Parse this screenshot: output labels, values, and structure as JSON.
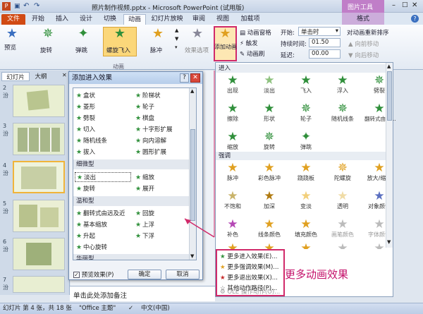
{
  "titlebar": {
    "title": "照片制作视频.pptx - Microsoft PowerPoint (试用版)",
    "context_tool": "图片工具"
  },
  "tabs": [
    "文件",
    "开始",
    "插入",
    "设计",
    "切换",
    "动画",
    "幻灯片放映",
    "审阅",
    "视图",
    "加载项",
    "格式"
  ],
  "ribbon": {
    "preview": "预览",
    "effects": [
      "旋转",
      "弹跳",
      "螺旋飞入",
      "脉冲"
    ],
    "effect_options": "效果选项",
    "group_animation": "动画",
    "add_animation": "添加动画",
    "animation_pane": "动画窗格",
    "trigger": "触发",
    "painter": "动画刷",
    "start_label": "开始:",
    "start_value": "单击时",
    "duration_label": "持续时间:",
    "duration_value": "01.50",
    "delay_label": "延迟:",
    "delay_value": "00.00",
    "reorder": "对动画重新排序",
    "move_earlier": "向前移动",
    "move_later": "向后移动"
  },
  "left_panel": {
    "tab_slides": "幻灯片",
    "tab_outline": "大纲",
    "slide_numbers": [
      "2",
      "3",
      "4",
      "5",
      "6",
      "7"
    ],
    "slide_suffix": "汾"
  },
  "dialog": {
    "title": "添加进入效果",
    "basic_items": [
      [
        "盒状",
        "阶梯状"
      ],
      [
        "菱形",
        "轮子"
      ],
      [
        "劈裂",
        "棋盘"
      ],
      [
        "切入",
        "十字形扩展"
      ],
      [
        "随机线条",
        "向内溶解"
      ],
      [
        "拔入",
        "圆形扩展"
      ]
    ],
    "section_subtle": "细微型",
    "subtle_items": [
      [
        "淡出",
        "缩放"
      ],
      [
        "旋转",
        "展开"
      ]
    ],
    "section_moderate": "温和型",
    "moderate_items": [
      [
        "翻转式由远及近",
        "回旋"
      ],
      [
        "基本缩放",
        "上浮"
      ],
      [
        "升起",
        "下浮"
      ],
      [
        "中心旋转",
        ""
      ]
    ],
    "section_exciting": "华丽型",
    "preview_checkbox": "预览效果(P)",
    "ok": "确定",
    "cancel": "取消"
  },
  "gallery": {
    "section_entrance": "进入",
    "entrance_row1": [
      "出现",
      "淡出",
      "飞入",
      "浮入",
      "劈裂"
    ],
    "entrance_row2": [
      "擦除",
      "形状",
      "轮子",
      "随机线条",
      "翻转式由远..."
    ],
    "entrance_row3": [
      "缩放",
      "旋转",
      "弹跳"
    ],
    "section_emphasis": "强调",
    "emphasis_row1": [
      "脉冲",
      "彩色脉冲",
      "跷跷板",
      "陀螺旋",
      "放大/缩小"
    ],
    "emphasis_row2": [
      "不饱和",
      "加深",
      "变淡",
      "透明",
      "对象颜色"
    ],
    "emphasis_row3": [
      "补色",
      "线条颜色",
      "填充颜色",
      "画笔颜色",
      "字体颜色"
    ],
    "menu": [
      "更多进入效果(E)...",
      "更多强调效果(M)...",
      "更多退出效果(X)...",
      "其他动作路径(P)...",
      "OLE 操作动作(O)..."
    ]
  },
  "annotation": "更多动画效果",
  "notes_placeholder": "单击此处添加备注",
  "status": {
    "slide": "幻灯片 第 4 张，共 18 张",
    "theme": "\"Office 主题\"",
    "language": "中文(中国)"
  },
  "colors": {
    "star_green": "#2f8f3a",
    "star_gold": "#e0a020",
    "annotation": "#c4106a",
    "file_tab": "#d14a14"
  }
}
